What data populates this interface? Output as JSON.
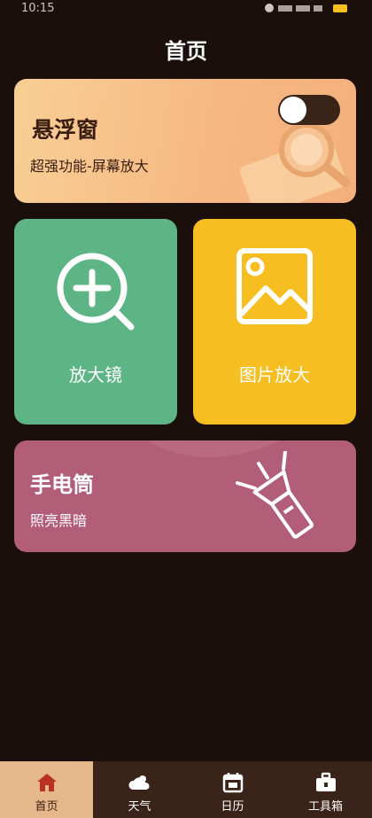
{
  "status": {
    "time": "10:15"
  },
  "header": {
    "title": "首页"
  },
  "float_card": {
    "title": "悬浮窗",
    "subtitle": "超强功能-屏幕放大",
    "toggle_on": false
  },
  "magnifier_card": {
    "label": "放大镜",
    "icon": "magnifier-plus-icon"
  },
  "photo_card": {
    "label": "图片放大",
    "icon": "image-icon"
  },
  "flashlight_card": {
    "title": "手电筒",
    "subtitle": "照亮黑暗",
    "icon": "flashlight-icon"
  },
  "tabbar": {
    "tabs": [
      {
        "label": "首页",
        "icon": "home-icon",
        "active": true
      },
      {
        "label": "天气",
        "icon": "weather-icon",
        "active": false
      },
      {
        "label": "日历",
        "icon": "calendar-icon",
        "active": false
      },
      {
        "label": "工具箱",
        "icon": "toolbox-icon",
        "active": false
      }
    ]
  },
  "colors": {
    "background": "#1a0f0b",
    "float_card": "#f6b782",
    "magnifier_card": "#5db585",
    "photo_card": "#f7be21",
    "flashlight_card": "#b25e78",
    "tabbar": "#3a2318",
    "tab_active": "#e6b78b",
    "battery": "#f7c21c"
  }
}
